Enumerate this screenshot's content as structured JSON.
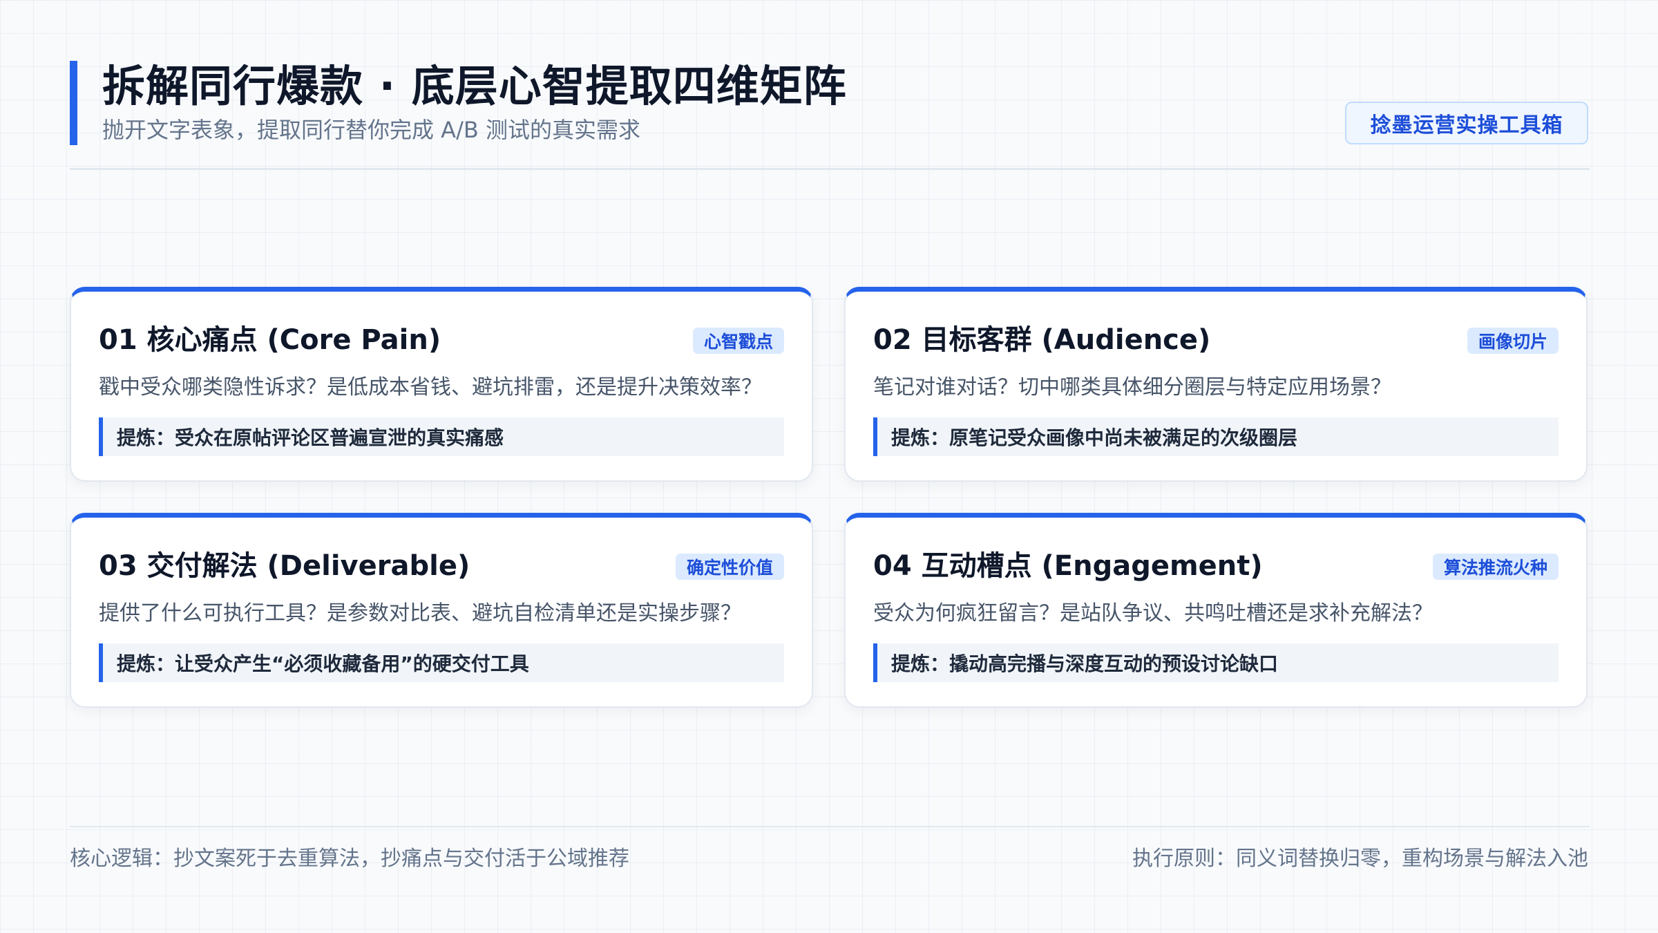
{
  "header": {
    "title": "拆解同行爆款 · 底层心智提取四维矩阵",
    "subtitle": "抛开文字表象，提取同行替你完成 A/B 测试的真实需求",
    "brand_badge": "捻墨运营实操工具箱"
  },
  "cards": [
    {
      "title": "01 核心痛点 (Core Pain)",
      "tag": "心智戳点",
      "description": "戳中受众哪类隐性诉求？是低成本省钱、避坑排雷，还是提升决策效率？",
      "extract": "提炼：受众在原帖评论区普遍宣泄的真实痛感"
    },
    {
      "title": "02 目标客群 (Audience)",
      "tag": "画像切片",
      "description": "笔记对谁对话？切中哪类具体细分圈层与特定应用场景？",
      "extract": "提炼：原笔记受众画像中尚未被满足的次级圈层"
    },
    {
      "title": "03 交付解法 (Deliverable)",
      "tag": "确定性价值",
      "description": "提供了什么可执行工具？是参数对比表、避坑自检清单还是实操步骤？",
      "extract": "提炼：让受众产生“必须收藏备用”的硬交付工具"
    },
    {
      "title": "04 互动槽点 (Engagement)",
      "tag": "算法推流火种",
      "description": "受众为何疯狂留言？是站队争议、共鸣吐槽还是求补充解法？",
      "extract": "提炼：撬动高完播与深度互动的预设讨论缺口"
    }
  ],
  "footer": {
    "left": "核心逻辑：抄文案死于去重算法，抄痛点与交付活于公域推荐",
    "right": "执行原则：同义词替换归零，重构场景与解法入池"
  },
  "colors": {
    "accent": "#2563eb",
    "tag_bg": "#dbeafe",
    "tag_text": "#1d4ed8",
    "title_text": "#0f172a",
    "muted_text": "#64748b"
  }
}
